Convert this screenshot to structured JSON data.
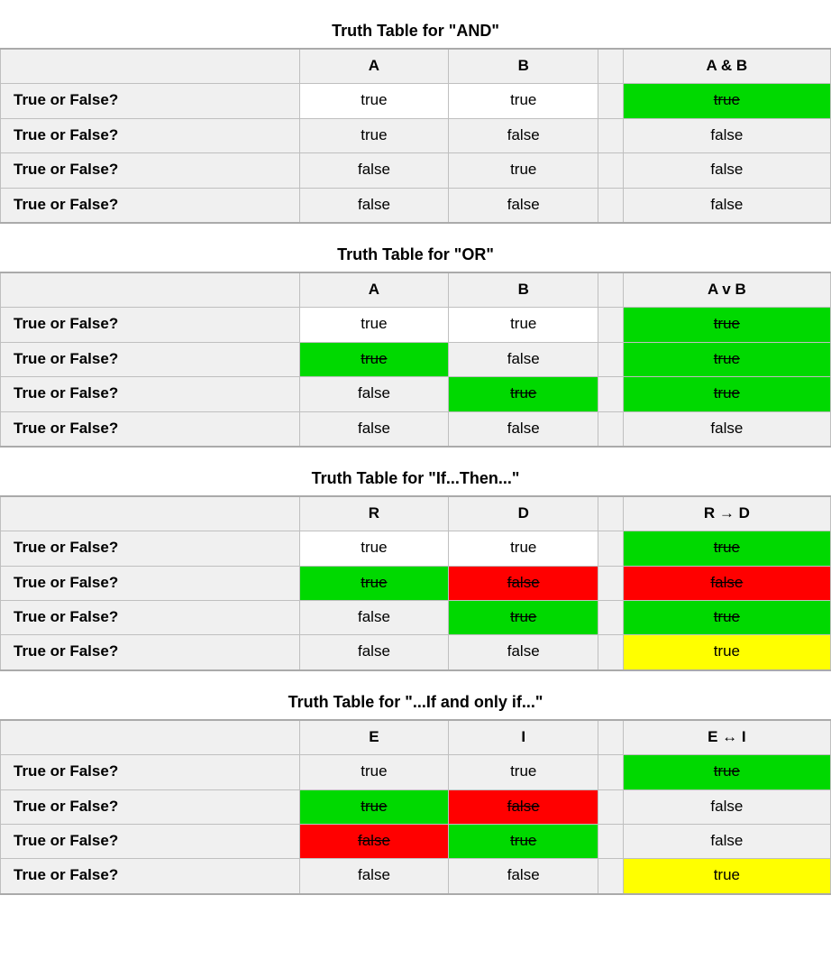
{
  "tables": [
    {
      "title": "Truth Table for \"AND\"",
      "columns": [
        "",
        "A",
        "B",
        "",
        "A & B"
      ],
      "row_label": "True or False?",
      "rows": [
        {
          "cells": [
            {
              "v": "true",
              "hl": "white"
            },
            {
              "v": "true",
              "hl": "white"
            },
            {
              "v": "",
              "hl": "plain"
            },
            {
              "v": "true",
              "hl": "green",
              "strike": true
            }
          ]
        },
        {
          "cells": [
            {
              "v": "true",
              "hl": "plain"
            },
            {
              "v": "false",
              "hl": "plain"
            },
            {
              "v": "",
              "hl": "plain"
            },
            {
              "v": "false",
              "hl": "plain"
            }
          ]
        },
        {
          "cells": [
            {
              "v": "false",
              "hl": "plain"
            },
            {
              "v": "true",
              "hl": "plain"
            },
            {
              "v": "",
              "hl": "plain"
            },
            {
              "v": "false",
              "hl": "plain"
            }
          ]
        },
        {
          "cells": [
            {
              "v": "false",
              "hl": "plain"
            },
            {
              "v": "false",
              "hl": "plain"
            },
            {
              "v": "",
              "hl": "plain"
            },
            {
              "v": "false",
              "hl": "plain"
            }
          ]
        }
      ]
    },
    {
      "title": "Truth Table for \"OR\"",
      "columns": [
        "",
        "A",
        "B",
        "",
        "A v B"
      ],
      "row_label": "True or False?",
      "rows": [
        {
          "cells": [
            {
              "v": "true",
              "hl": "white"
            },
            {
              "v": "true",
              "hl": "white"
            },
            {
              "v": "",
              "hl": "plain"
            },
            {
              "v": "true",
              "hl": "green",
              "strike": true
            }
          ]
        },
        {
          "cells": [
            {
              "v": "true",
              "hl": "green",
              "strike": true
            },
            {
              "v": "false",
              "hl": "plain"
            },
            {
              "v": "",
              "hl": "plain"
            },
            {
              "v": "true",
              "hl": "green",
              "strike": true
            }
          ]
        },
        {
          "cells": [
            {
              "v": "false",
              "hl": "plain"
            },
            {
              "v": "true",
              "hl": "green",
              "strike": true
            },
            {
              "v": "",
              "hl": "plain"
            },
            {
              "v": "true",
              "hl": "green",
              "strike": true
            }
          ]
        },
        {
          "cells": [
            {
              "v": "false",
              "hl": "plain"
            },
            {
              "v": "false",
              "hl": "plain"
            },
            {
              "v": "",
              "hl": "plain"
            },
            {
              "v": "false",
              "hl": "plain"
            }
          ]
        }
      ]
    },
    {
      "title": "Truth Table for \"If...Then...\"",
      "columns": [
        "",
        "R",
        "D",
        "",
        "R → D"
      ],
      "row_label": "True or False?",
      "rows": [
        {
          "cells": [
            {
              "v": "true",
              "hl": "white"
            },
            {
              "v": "true",
              "hl": "white"
            },
            {
              "v": "",
              "hl": "plain"
            },
            {
              "v": "true",
              "hl": "green",
              "strike": true
            }
          ]
        },
        {
          "cells": [
            {
              "v": "true",
              "hl": "green",
              "strike": true
            },
            {
              "v": "false",
              "hl": "red",
              "strike": true
            },
            {
              "v": "",
              "hl": "plain"
            },
            {
              "v": "false",
              "hl": "red",
              "strike": true
            }
          ]
        },
        {
          "cells": [
            {
              "v": "false",
              "hl": "plain"
            },
            {
              "v": "true",
              "hl": "green",
              "strike": true
            },
            {
              "v": "",
              "hl": "plain"
            },
            {
              "v": "true",
              "hl": "green",
              "strike": true
            }
          ]
        },
        {
          "cells": [
            {
              "v": "false",
              "hl": "plain"
            },
            {
              "v": "false",
              "hl": "plain"
            },
            {
              "v": "",
              "hl": "plain"
            },
            {
              "v": "true",
              "hl": "yellow"
            }
          ]
        }
      ]
    },
    {
      "title": "Truth Table for \"...If and only if...\"",
      "columns": [
        "",
        "E",
        "I",
        "",
        "E ↔ I"
      ],
      "row_label": "True or False?",
      "rows": [
        {
          "cells": [
            {
              "v": "true",
              "hl": "plain"
            },
            {
              "v": "true",
              "hl": "plain"
            },
            {
              "v": "",
              "hl": "plain"
            },
            {
              "v": "true",
              "hl": "green",
              "strike": true
            }
          ]
        },
        {
          "cells": [
            {
              "v": "true",
              "hl": "green",
              "strike": true
            },
            {
              "v": "false",
              "hl": "red",
              "strike": true
            },
            {
              "v": "",
              "hl": "plain"
            },
            {
              "v": "false",
              "hl": "plain"
            }
          ]
        },
        {
          "cells": [
            {
              "v": "false",
              "hl": "red",
              "strike": true
            },
            {
              "v": "true",
              "hl": "green",
              "strike": true
            },
            {
              "v": "",
              "hl": "plain"
            },
            {
              "v": "false",
              "hl": "plain"
            }
          ]
        },
        {
          "cells": [
            {
              "v": "false",
              "hl": "plain"
            },
            {
              "v": "false",
              "hl": "plain"
            },
            {
              "v": "",
              "hl": "plain"
            },
            {
              "v": "true",
              "hl": "yellow"
            }
          ]
        }
      ]
    }
  ]
}
